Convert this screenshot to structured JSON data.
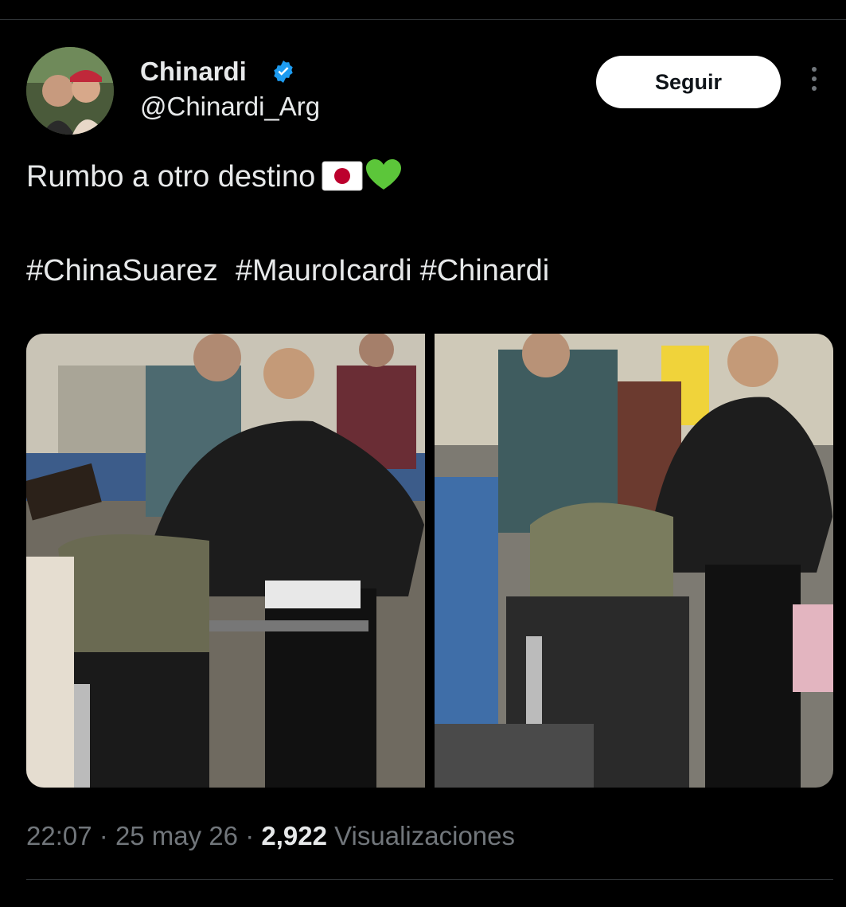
{
  "tweet": {
    "author": {
      "display_name": "Chinardi",
      "handle": "@Chinardi_Arg",
      "verified": true,
      "avatar_icon": "profile-photo"
    },
    "follow_label": "Seguir",
    "more_icon": "more-vertical-icon",
    "text": "Rumbo a otro destino",
    "emojis": [
      "japan-flag",
      "green-heart"
    ],
    "hashtags": [
      "#ChinaSuarez",
      "#MauroIcardi",
      "#Chinardi"
    ],
    "media": [
      {
        "name": "photo-1"
      },
      {
        "name": "photo-2"
      }
    ],
    "meta": {
      "time": "22:07",
      "separator": "·",
      "date": "25 may 26",
      "views_count": "2,922",
      "views_label": "Visualizaciones"
    }
  },
  "colors": {
    "background": "#000000",
    "text": "#e7e9ea",
    "secondary_text": "#71767b",
    "verified": "#1d9bf0",
    "divider": "#2f3336"
  }
}
